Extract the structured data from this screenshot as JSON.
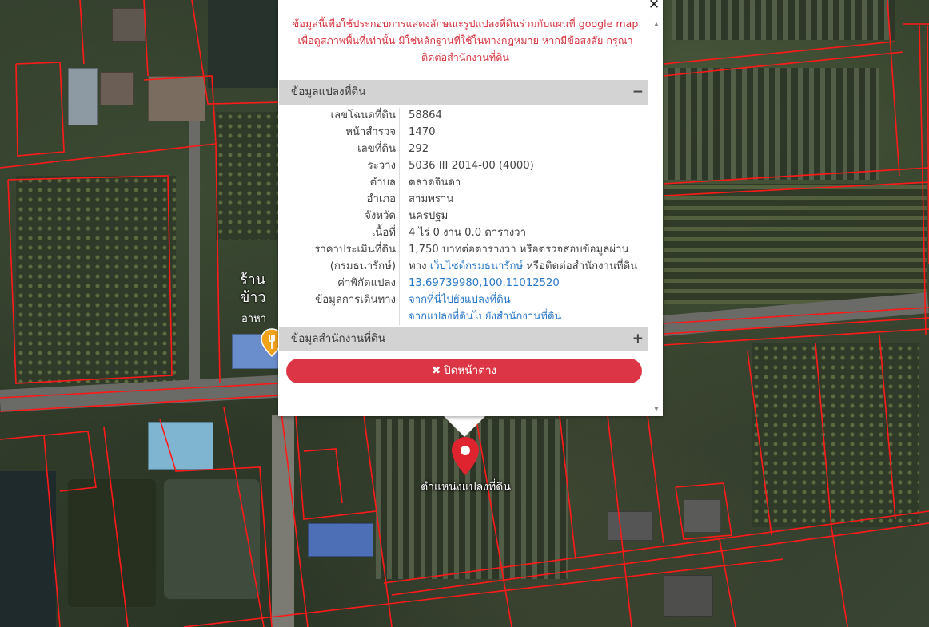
{
  "popup": {
    "close_symbol": "✕",
    "disclaimer_lines": [
      "ข้อมูลนี้เพื่อใช้ประกอบการแสดงลักษณะรูปแปลงที่ดินร่วมกับแผนที่ google map",
      "เพื่อดูสภาพพื้นที่เท่านั้น มิใช่หลักฐานที่ใช้ในทางกฎหมาย หากมีข้อสงสัย กรุณา",
      "ติดต่อสำนักงานที่ดิน"
    ],
    "section_land": {
      "title": "ข้อมูลแปลงที่ดิน",
      "toggle": "−"
    },
    "section_office": {
      "title": "ข้อมูลสำนักงานที่ดิน",
      "toggle": "+"
    },
    "fields": {
      "deed_no": {
        "label": "เลขโฉนดที่ดิน",
        "value": "58864"
      },
      "survey_page": {
        "label": "หน้าสำรวจ",
        "value": "1470"
      },
      "land_no": {
        "label": "เลขที่ดิน",
        "value": "292"
      },
      "map_sheet": {
        "label": "ระวาง",
        "value": "5036 III 2014-00 (4000)"
      },
      "subdistrict": {
        "label": "ตำบล",
        "value": "ตลาดจินดา"
      },
      "district": {
        "label": "อำเภอ",
        "value": "สามพราน"
      },
      "province": {
        "label": "จังหวัด",
        "value": "นครปฐม"
      },
      "area": {
        "label": "เนื้อที่",
        "value": "4 ไร่ 0 งาน 0.0 ตารางวา"
      },
      "price": {
        "label": "ราคาประเมินที่ดิน",
        "label2": "(กรมธนารักษ์)",
        "value": "1,750 บาทต่อตารางวา หรือตรวจสอบข้อมูลผ่าน",
        "value2_prefix": "ทาง ",
        "value2_link": "เว็บไซต์กรมธนารักษ์",
        "value2_suffix": " หรือติดต่อสำนักงานที่ดิน"
      },
      "coords": {
        "label": "ค่าพิกัดแปลง",
        "value": "13.69739980,100.11012520"
      },
      "directions": {
        "label": "ข้อมูลการเดินทาง",
        "link1": "จากที่นี่ไปยังแปลงที่ดิน",
        "link2": "จากแปลงที่ดินไปยังสำนักงานที่ดิน"
      }
    },
    "close_button": {
      "icon": "✖",
      "label": "ปิดหน้าต่าง"
    }
  },
  "map": {
    "marker_label": "ตำแหน่งแปลงที่ดิน",
    "shop_label_line1": "ร้าน",
    "shop_label_line2": "ข้าว",
    "shop_label_line3": "อาหา",
    "parcel_color": "#ff1a1a",
    "marker_color": "#e0242f"
  }
}
